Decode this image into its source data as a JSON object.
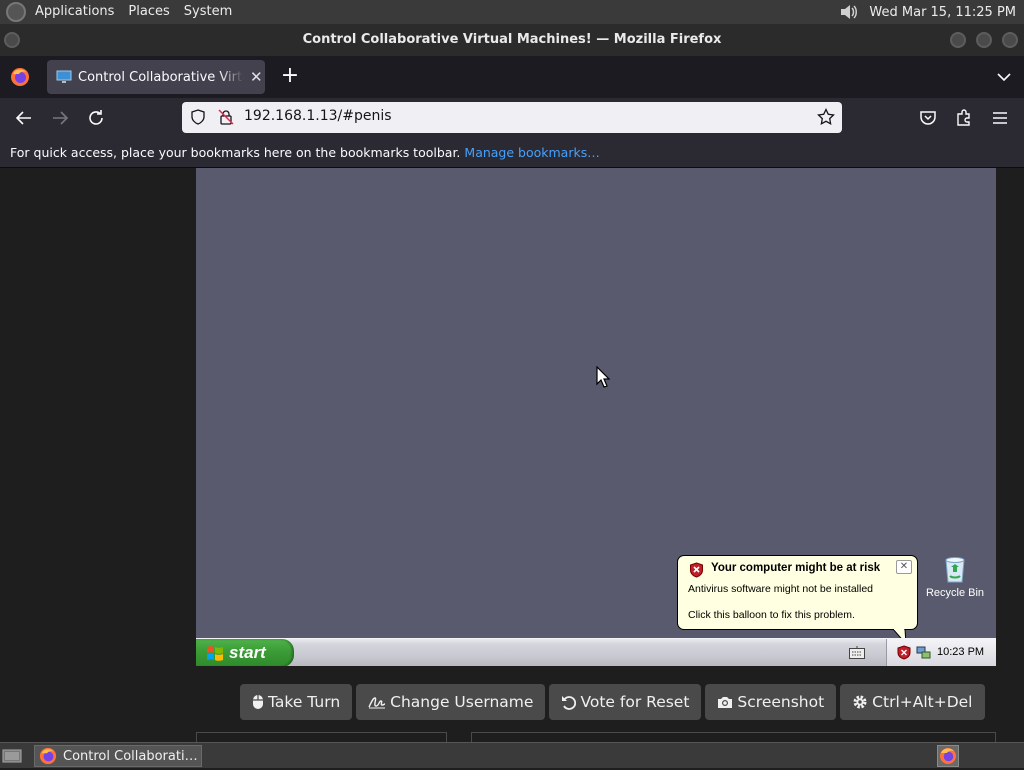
{
  "top_panel": {
    "menus": [
      "Applications",
      "Places",
      "System"
    ],
    "datetime": "Wed Mar 15, 11:25 PM"
  },
  "window": {
    "title": "Control Collaborative Virtual Machines! — Mozilla Firefox"
  },
  "browser": {
    "tab_title": "Control Collaborative Virtual Machines!",
    "tab_close": "✕",
    "new_tab": "+",
    "url": "192.168.1.13/#penis",
    "bookmarks_hint": "For quick access, place your bookmarks here on the bookmarks toolbar.",
    "manage_bookmarks": "Manage bookmarks…"
  },
  "vm": {
    "recycle_bin_label": "Recycle Bin",
    "balloon": {
      "title": "Your computer might be at risk",
      "line1": "Antivirus software might not be installed",
      "line2": "Click this balloon to fix this problem.",
      "close": "✕"
    },
    "start_label": "start",
    "clock": "10:23 PM"
  },
  "controls": {
    "take_turn": "Take Turn",
    "change_username": "Change Username",
    "vote_reset": "Vote for Reset",
    "screenshot": "Screenshot",
    "ctrl_alt_del": "Ctrl+Alt+Del"
  },
  "taskbar": {
    "firefox_task": "Control Collaborati…"
  },
  "colors": {
    "vm_background": "#5a5a6e",
    "firefox_toolbar": "#2b2a33",
    "link": "#45a1ff",
    "xp_start_green": "#3b9b36",
    "balloon_bg": "#ffffe1"
  }
}
